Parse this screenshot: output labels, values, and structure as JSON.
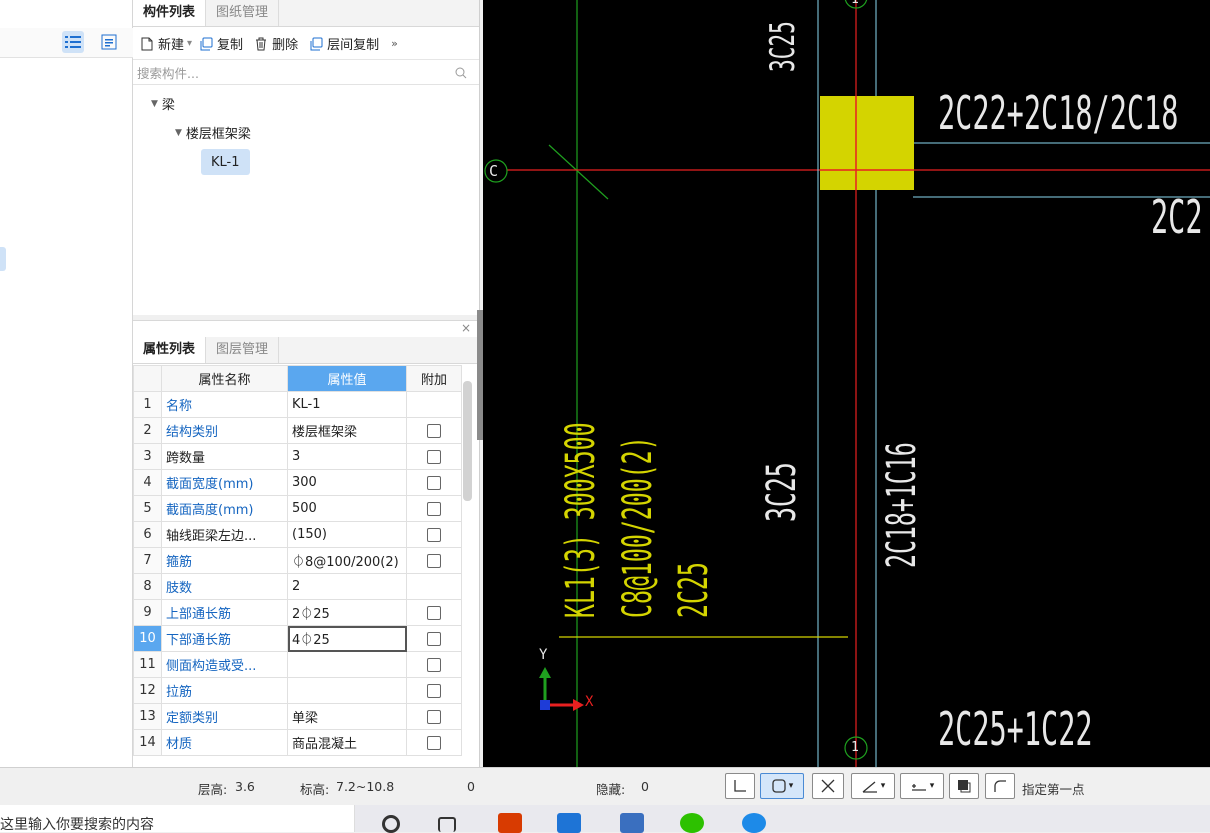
{
  "component_panel": {
    "tabs": [
      "构件列表",
      "图纸管理"
    ],
    "toolbar": {
      "new": "新建",
      "copy": "复制",
      "delete": "删除",
      "floor_copy": "层间复制"
    },
    "search_placeholder": "搜索构件...",
    "tree": {
      "root": "梁",
      "child": "楼层框架梁",
      "leaf": "KL-1"
    }
  },
  "property_panel": {
    "tabs": [
      "属性列表",
      "图层管理"
    ],
    "columns": [
      "属性名称",
      "属性值",
      "附加"
    ],
    "rows": [
      {
        "n": "1",
        "name": "名称",
        "value": "KL-1",
        "blue": true,
        "cb": false
      },
      {
        "n": "2",
        "name": "结构类别",
        "value": "楼层框架梁",
        "blue": true,
        "cb": true
      },
      {
        "n": "3",
        "name": "跨数量",
        "value": "3",
        "blue": false,
        "cb": true
      },
      {
        "n": "4",
        "name": "截面宽度(mm)",
        "value": "300",
        "blue": true,
        "cb": true
      },
      {
        "n": "5",
        "name": "截面高度(mm)",
        "value": "500",
        "blue": true,
        "cb": true
      },
      {
        "n": "6",
        "name": "轴线距梁左边...",
        "value": "(150)",
        "blue": false,
        "cb": true
      },
      {
        "n": "7",
        "name": "箍筋",
        "value": "⏀8@100/200(2)",
        "blue": true,
        "cb": true
      },
      {
        "n": "8",
        "name": "肢数",
        "value": "2",
        "blue": true,
        "cb": false
      },
      {
        "n": "9",
        "name": "上部通长筋",
        "value": "2⏀25",
        "blue": true,
        "cb": true
      },
      {
        "n": "10",
        "name": "下部通长筋",
        "value": "4⏀25",
        "blue": true,
        "cb": true
      },
      {
        "n": "11",
        "name": "侧面构造或受...",
        "value": "",
        "blue": true,
        "cb": true
      },
      {
        "n": "12",
        "name": "拉筋",
        "value": "",
        "blue": true,
        "cb": true
      },
      {
        "n": "13",
        "name": "定额类别",
        "value": "单梁",
        "blue": true,
        "cb": true
      },
      {
        "n": "14",
        "name": "材质",
        "value": "商品混凝土",
        "blue": true,
        "cb": true
      }
    ]
  },
  "cad": {
    "axis_c": "C",
    "axis_1_top": "1",
    "axis_1_bottom": "1",
    "texts": {
      "top_3c25": "3C25",
      "top_right": "2C22+2C18/2C18",
      "mid_right": "2C2",
      "beam_name": "KL1(3) 300X500",
      "stirrup": "C8@100/200(2)",
      "top_bar": "2C25",
      "center_3c25": "3C25",
      "vertical_right": "2C18+1C16",
      "bottom_right": "2C25+1C22",
      "axis_y": "Y",
      "axis_x": "X"
    },
    "colors": {
      "text": "#e8e8e8",
      "yellow": "#d4d400",
      "red": "#e82020",
      "green": "#1fa01f",
      "cyan": "#8ad8f0"
    }
  },
  "status_bar": {
    "floor_height_label": "层高:",
    "floor_height": "3.6",
    "elevation_label": "标高:",
    "elevation": "7.2~10.8",
    "count": "0",
    "hidden_label": "隐藏:",
    "hidden": "0",
    "prompt": "指定第一点"
  },
  "taskbar": {
    "search_text": "这里输入你要搜索的内容"
  }
}
